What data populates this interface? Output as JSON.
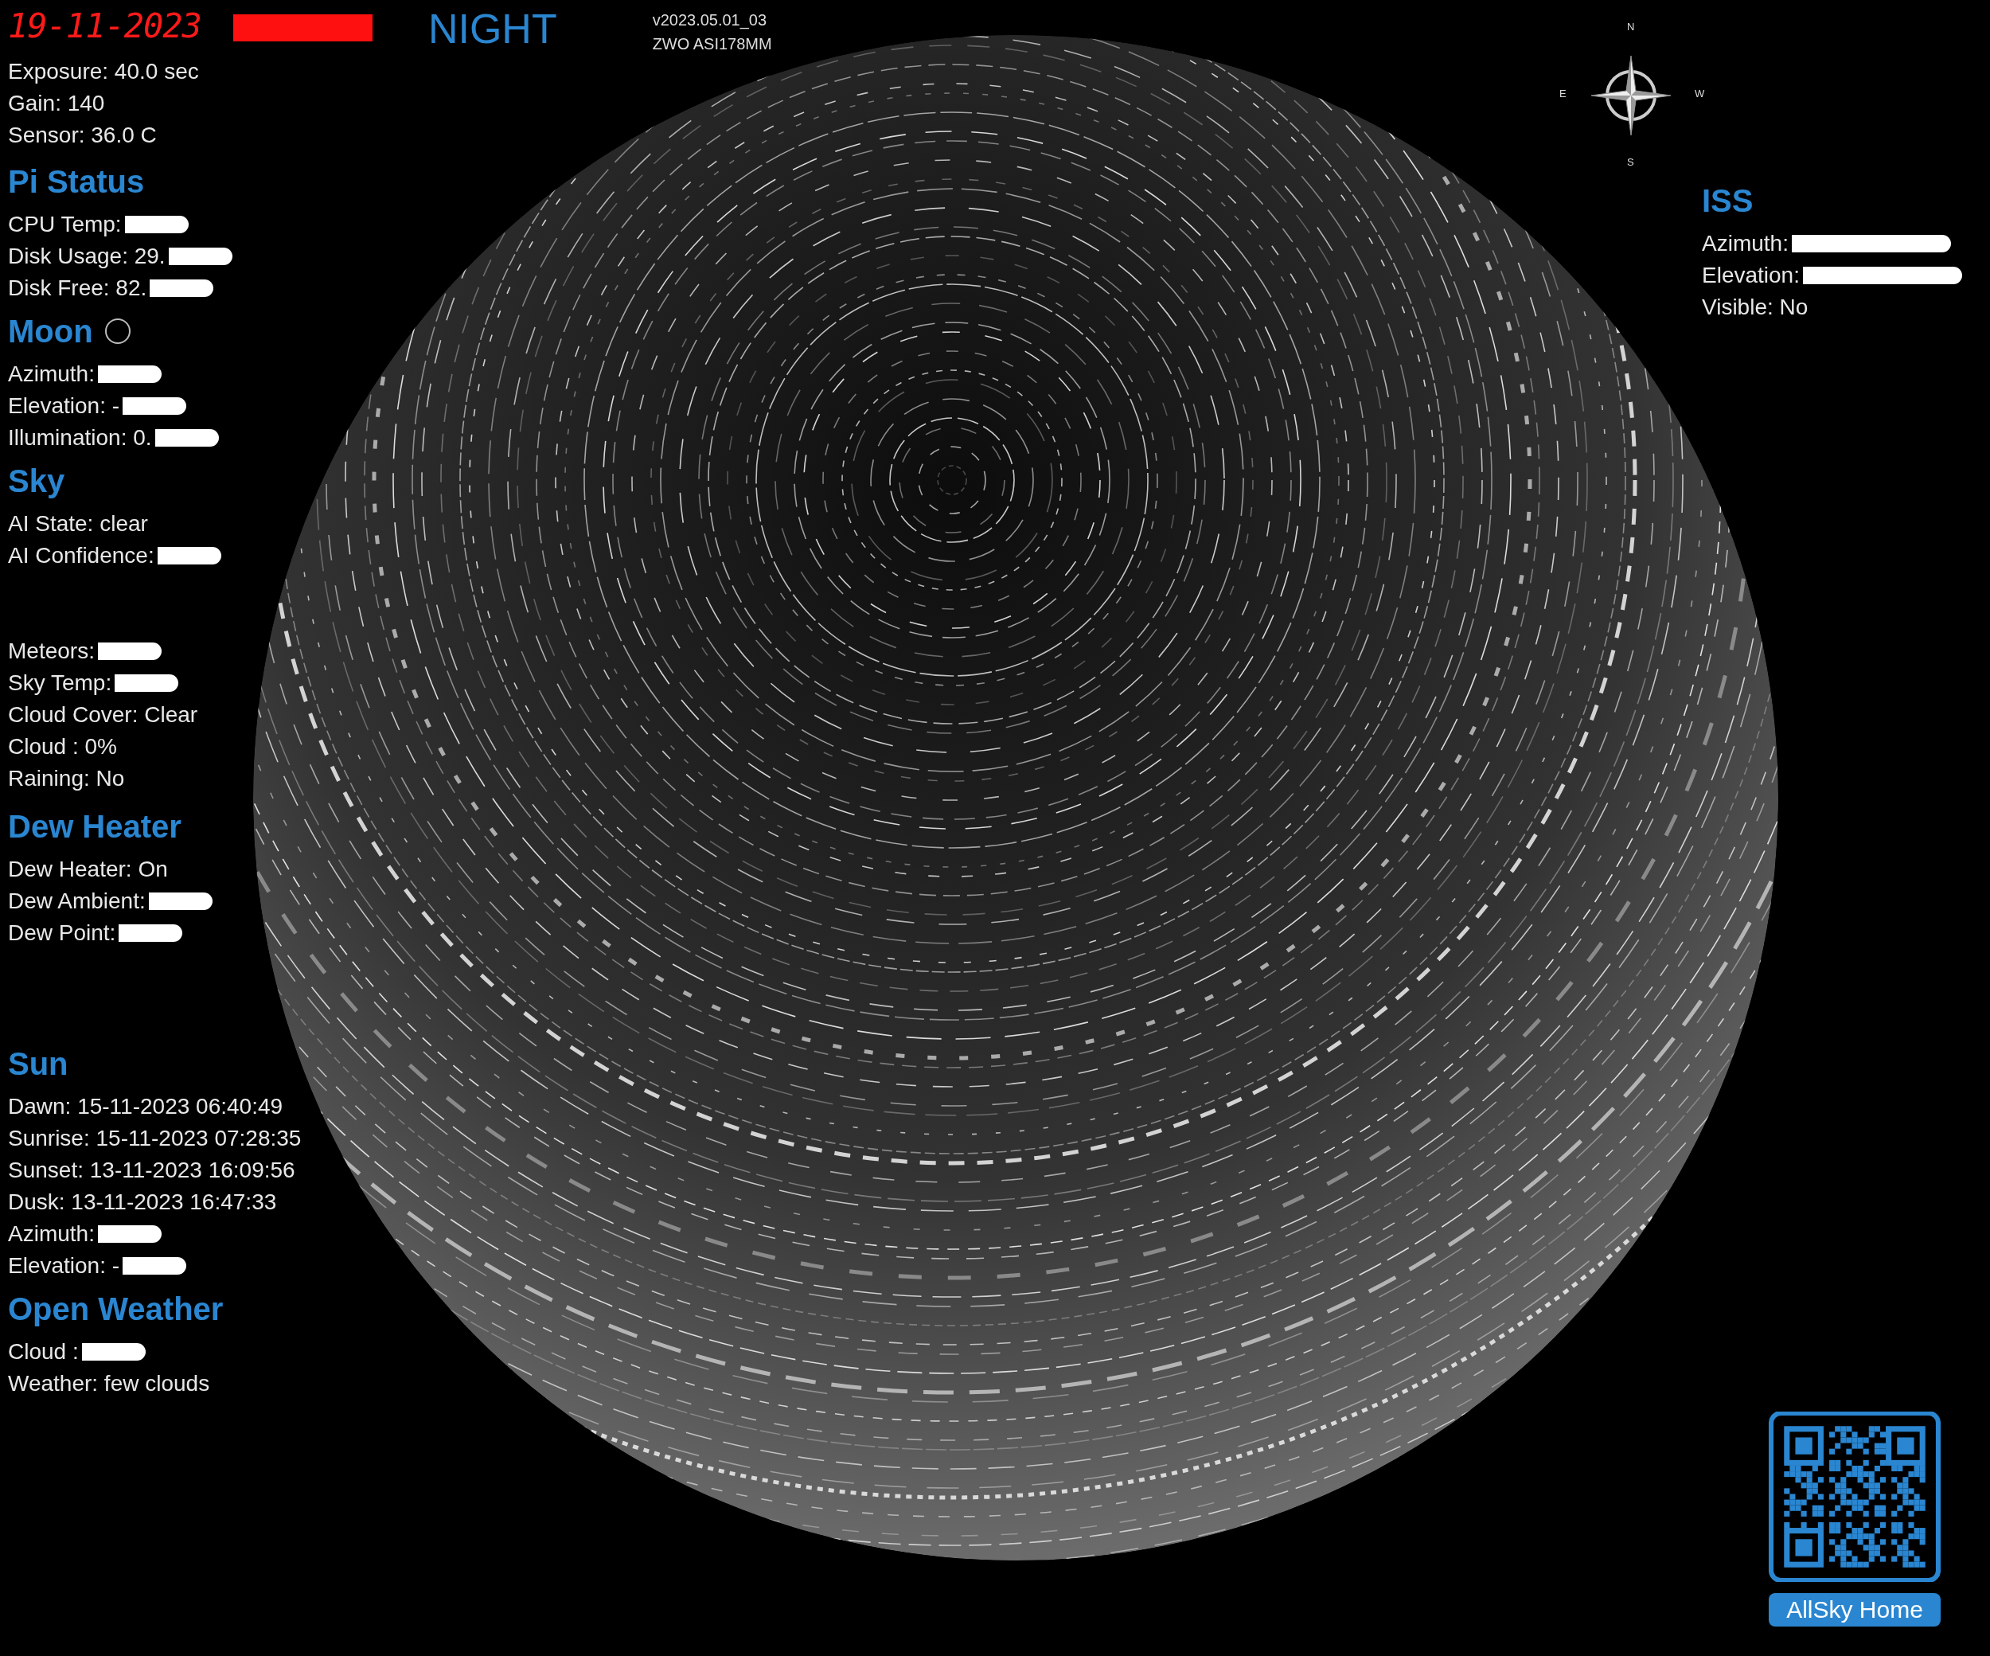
{
  "header": {
    "date": "19-11-2023",
    "time_obscured": true,
    "mode": "NIGHT",
    "version": "v2023.05.01_03",
    "camera": "ZWO ASI178MM"
  },
  "sections": [
    {
      "items": [
        {
          "label": "Exposure:",
          "value": "40.0 sec",
          "obscured": false
        },
        {
          "label": "Gain:",
          "value": "140",
          "obscured": false
        },
        {
          "label": "Sensor:",
          "value": "36.0 C",
          "obscured": false
        }
      ]
    },
    {
      "title": "Pi Status",
      "items": [
        {
          "label": "CPU Temp:",
          "value": "",
          "obscured": true
        },
        {
          "label": "Disk Usage:",
          "value": "29.",
          "obscured": true
        },
        {
          "label": "Disk Free:",
          "value": "82.",
          "obscured": true
        }
      ]
    },
    {
      "title": "Moon",
      "moon_icon": true,
      "items": [
        {
          "label": "Azimuth:",
          "value": "",
          "obscured": true
        },
        {
          "label": "Elevation: -",
          "value": "",
          "obscured": true
        },
        {
          "label": "Illumination:",
          "value": "0.",
          "obscured": true
        }
      ]
    },
    {
      "title": "Sky",
      "items": [
        {
          "label": "AI State:",
          "value": "clear",
          "obscured": false
        },
        {
          "label": "AI Confidence:",
          "value": "",
          "obscured": true
        }
      ]
    },
    {
      "items": [
        {
          "label": "Meteors:",
          "value": "",
          "obscured": true
        },
        {
          "label": "Sky Temp:",
          "value": "",
          "obscured": true
        },
        {
          "label": "Cloud Cover:",
          "value": "Clear",
          "obscured": false
        },
        {
          "label": "Cloud :",
          "value": "0%",
          "obscured": false
        },
        {
          "label": "Raining:",
          "value": "No",
          "obscured": false
        }
      ]
    },
    {
      "title": "Dew Heater",
      "items": [
        {
          "label": "Dew Heater:",
          "value": "On",
          "obscured": false
        },
        {
          "label": "Dew Ambient:",
          "value": "",
          "obscured": true
        },
        {
          "label": "Dew Point:",
          "value": "",
          "obscured": true
        }
      ]
    },
    {
      "title": "Sun",
      "items": [
        {
          "label": "Dawn:",
          "value": "15-11-2023 06:40:49",
          "obscured": false
        },
        {
          "label": "Sunrise:",
          "value": "15-11-2023 07:28:35",
          "obscured": false
        },
        {
          "label": "Sunset:",
          "value": "13-11-2023 16:09:56",
          "obscured": false
        },
        {
          "label": "Dusk:",
          "value": "13-11-2023 16:47:33",
          "obscured": false
        },
        {
          "label": "Azimuth:",
          "value": "",
          "obscured": true
        },
        {
          "label": "Elevation: -",
          "value": "",
          "obscured": true
        }
      ]
    },
    {
      "title": "Open Weather",
      "items": [
        {
          "label": "Cloud :",
          "value": "",
          "obscured": true
        },
        {
          "label": "Weather:",
          "value": "few clouds",
          "obscured": false
        }
      ]
    }
  ],
  "compass": {
    "north": "N",
    "east": "E",
    "south": "S",
    "west": "W"
  },
  "iss": {
    "title": "ISS",
    "items": [
      {
        "label": "Azimuth:",
        "value": "",
        "obscured": true
      },
      {
        "label": "Elevation:",
        "value": "",
        "obscured": true
      },
      {
        "label": "Visible:",
        "value": "No",
        "obscured": false
      }
    ]
  },
  "qr": {
    "label": "AllSky Home"
  }
}
